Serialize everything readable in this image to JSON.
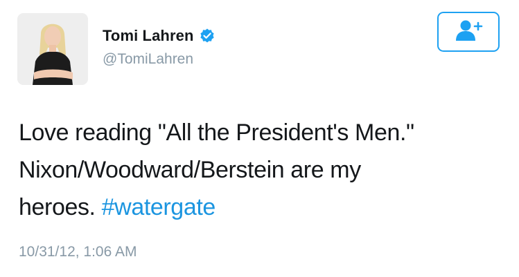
{
  "user": {
    "display_name": "Tomi Lahren",
    "handle": "@TomiLahren",
    "verified": true,
    "avatar_icon": "profile-photo"
  },
  "follow_button": {
    "icon": "follow-user-plus-icon"
  },
  "tweet": {
    "lines": [
      "Love reading \"All the President's Men.\"",
      "Nixon/Woodward/Berstein are my",
      "heroes. "
    ],
    "hashtag": "#watergate",
    "timestamp": "10/31/12, 1:06 AM"
  },
  "colors": {
    "accent": "#1da1f2",
    "hashtag": "#1b95e0",
    "secondary_text": "#8899a6",
    "primary_text": "#14171a"
  }
}
